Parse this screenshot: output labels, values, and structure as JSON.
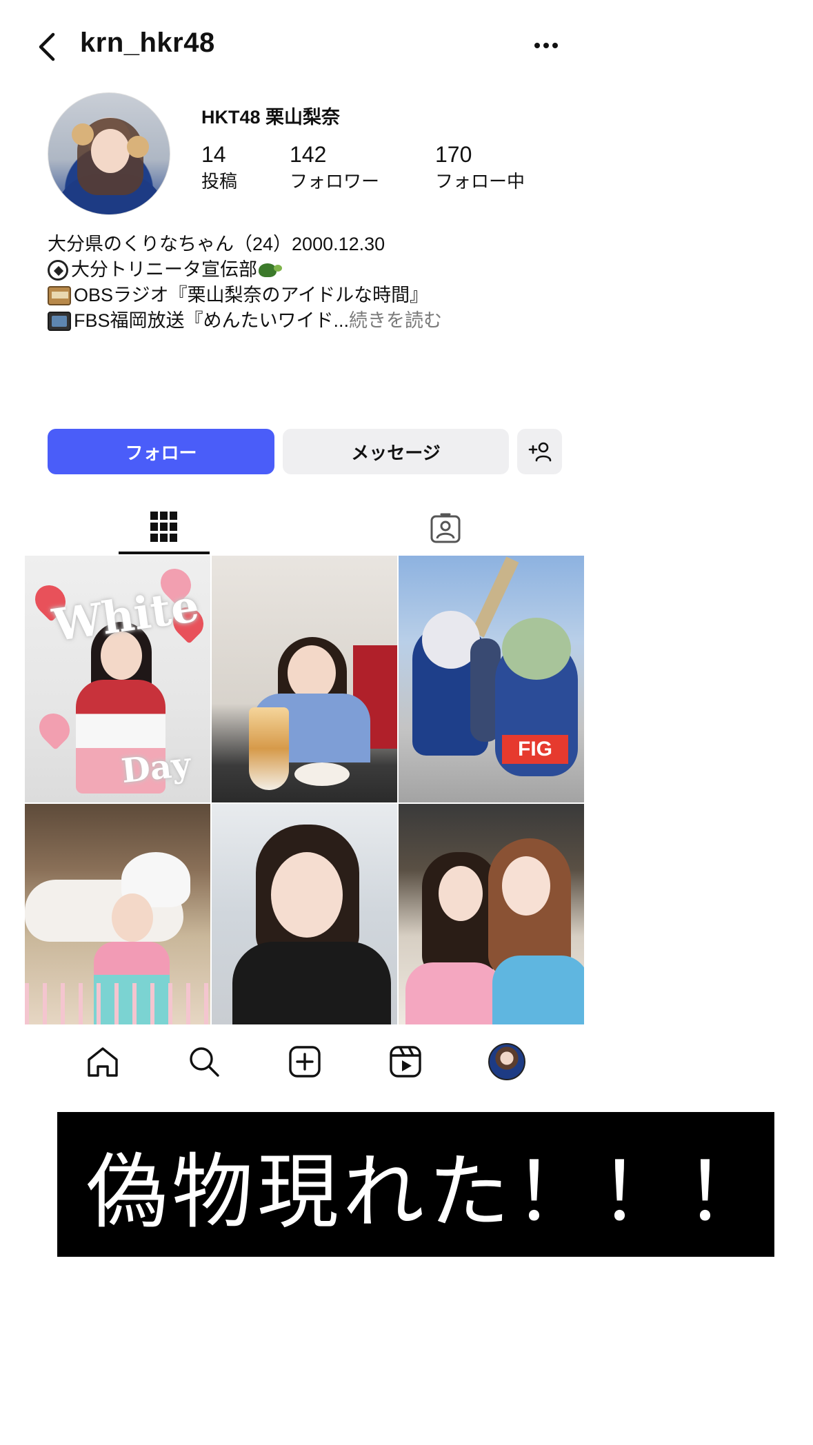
{
  "header": {
    "username": "krn_hkr48",
    "back_icon": "chevron-left-icon",
    "more_icon": "more-horizontal-icon"
  },
  "profile": {
    "display_name": "HKT48 栗山梨奈",
    "stats": {
      "posts_count": "14",
      "posts_label": "投稿",
      "followers_count": "142",
      "followers_label": "フォロワー",
      "following_count": "170",
      "following_label": "フォロー中"
    },
    "bio": {
      "line1": "大分県のくりなちゃん（24）2000.12.30",
      "line2": "大分トリニータ宣伝部",
      "line3": "OBSラジオ『栗山梨奈のアイドルな時間』",
      "line4": "FBS福岡放送『めんたいワイド...",
      "more": " 続きを読む"
    }
  },
  "actions": {
    "follow_label": "フォロー",
    "message_label": "メッセージ",
    "follow_color": "#4a5df9"
  },
  "tabs": {
    "grid_icon": "grid-icon",
    "tagged_icon": "tagged-person-icon"
  },
  "grid": {
    "tile1_text_a": "White",
    "tile1_text_b": "Day",
    "tile3_text": "FIG"
  },
  "bottom_nav": {
    "items": [
      "home-icon",
      "search-icon",
      "create-icon",
      "reels-icon",
      "profile-avatar"
    ]
  },
  "banner": {
    "text": "偽物現れた！！！"
  }
}
